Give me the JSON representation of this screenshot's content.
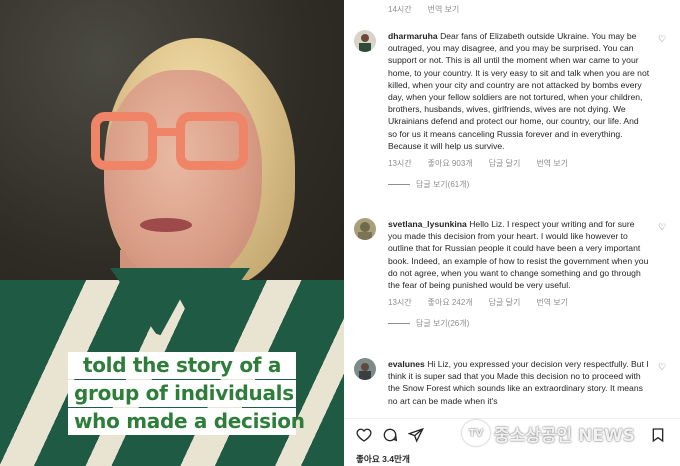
{
  "video": {
    "caption_lines": [
      "told the story of a",
      "group of individuals",
      "who made a decision"
    ]
  },
  "top_meta": {
    "time": "14시간",
    "translate": "번역 보기"
  },
  "comments": [
    {
      "username": "dharmaruha",
      "text": "Dear fans of Elizabeth outside Ukraine. You may be outraged, you may disagree, and you may be surprised. You can support or not. This is all until the moment when war came to your home, to your country. It is very easy to sit and talk when you are not killed, when your city and country are not attacked by bombs every day, when your fellow soldiers are not tortured, when your children, brothers, husbands, wives, girlfriends, wives are not dying. We Ukrainians defend and protect our home, our country, our life. And so for us it means canceling Russia forever and in everything. Because it will help us survive.",
      "time": "13시간",
      "likes": "좋아요 903개",
      "reply": "답글 달기",
      "translate": "번역 보기",
      "view_replies": "답글 보기(61개)"
    },
    {
      "username": "svetlana_lysunkina",
      "text": "Hello Liz. I respect your writing and for sure you made this decision from your heart. I would like however to outline that for Russian people it could have been a very important book. Indeed, an example of how to resist the government when you do not agree, when you want to change something and go through the fear of being punished would be very useful.",
      "time": "13시간",
      "likes": "좋아요 242개",
      "reply": "답글 달기",
      "translate": "번역 보기",
      "view_replies": "답글 보기(26개)"
    },
    {
      "username": "evalunes",
      "text": "Hi Liz, you expressed your decision very respectfully. But I think it is super sad that you Made this decision no to proceed with the Snow Forest which sounds like an extraordinary story. It means no art can be made when it's"
    }
  ],
  "footer": {
    "likes": "좋아요 3.4만개"
  },
  "watermark": {
    "logo": "TV",
    "text": "중소상공인 NEWS"
  },
  "colors": {
    "caption_text": "#2e7d3a",
    "muted": "#8e8e8e",
    "text": "#262626"
  }
}
